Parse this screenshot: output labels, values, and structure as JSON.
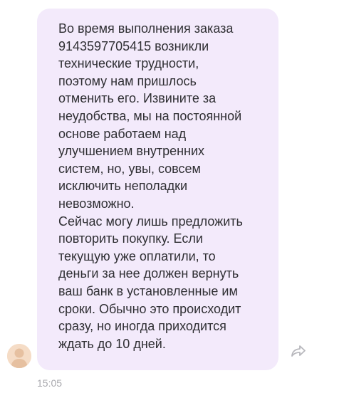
{
  "message": {
    "lines": [
      "Во время выполнения заказа",
      "9143597705415 возникли",
      "технические трудности,",
      "поэтому нам пришлось",
      "отменить его. Извините за",
      "неудобства, мы на постоянной",
      "основе работаем над",
      "улучшением внутренних",
      "систем, но, увы, совсем",
      "исключить неполадки",
      "невозможно.",
      "Сейчас могу лишь предложить",
      "повторить покупку. Если",
      "текущую уже оплатили, то",
      "деньги за нее должен вернуть",
      "ваш банк в установленные им",
      "сроки. Обычно это происходит",
      "сразу, но иногда приходится",
      "ждать до 10 дней."
    ],
    "time": "15:05",
    "avatar_icon": "user-avatar-icon",
    "forward_icon": "forward-arrow-icon"
  },
  "colors": {
    "bubble": "#f3eafb",
    "text": "#2f2f33",
    "time": "#a8a8ad",
    "avatar": "#f5dcc6",
    "icon": "#b8b8bd"
  }
}
